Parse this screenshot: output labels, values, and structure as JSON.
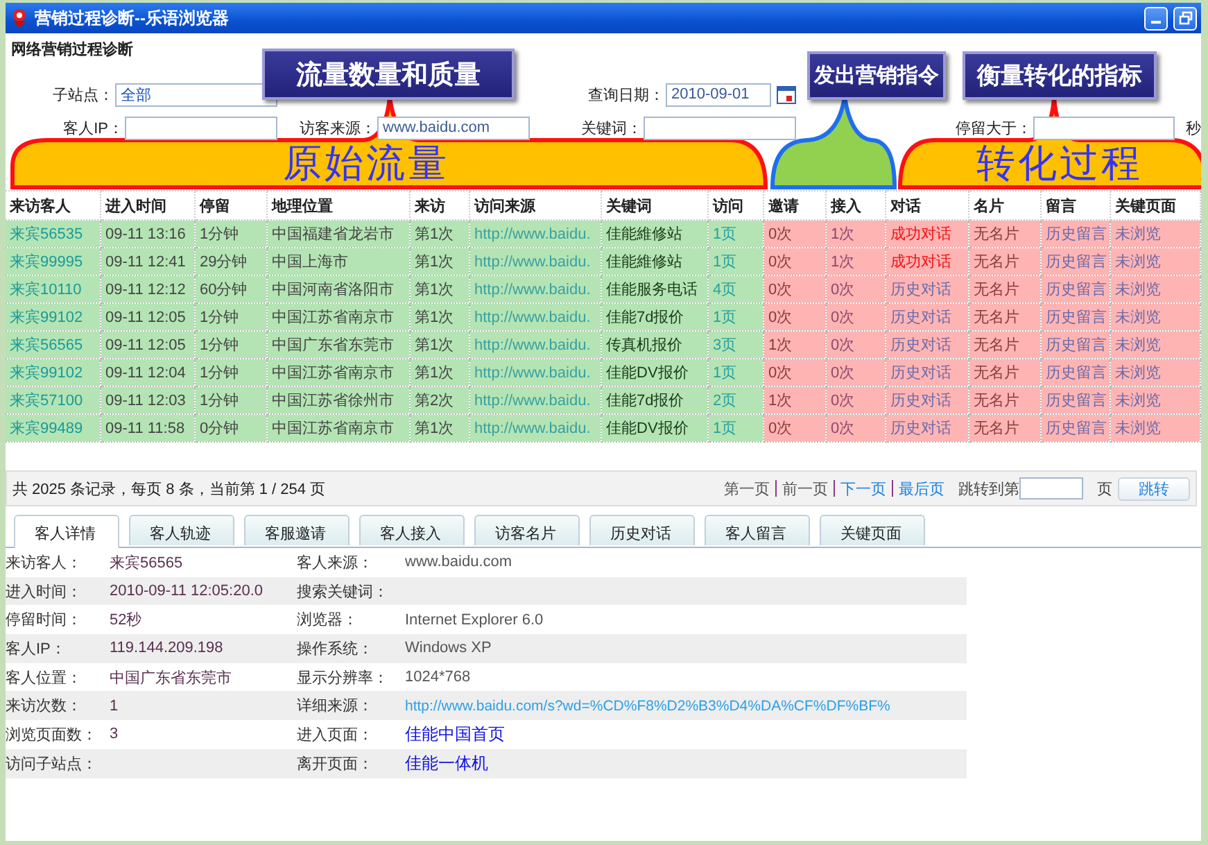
{
  "window": {
    "title": "营销过程诊断--乐语浏览器"
  },
  "page_title": "网络营销过程诊断",
  "filters": [
    {
      "label": "子站点：",
      "kind": "select",
      "value": "全部"
    },
    {
      "label": "查询日期：",
      "kind": "date",
      "value": "2010-09-01"
    },
    {
      "label": "客人IP：",
      "kind": "text"
    },
    {
      "label": "访客来源：",
      "kind": "text",
      "value": "www.baidu.com"
    },
    {
      "label": "关键词：",
      "kind": "text"
    },
    {
      "label": "停留大于：",
      "kind": "text",
      "unit": "秒"
    }
  ],
  "table": {
    "columns": [
      {
        "label": "来访客人",
        "kind": "traffic"
      },
      {
        "label": "进入时间",
        "kind": "traffic"
      },
      {
        "label": "停留",
        "kind": "traffic"
      },
      {
        "label": "地理位置",
        "kind": "traffic"
      },
      {
        "label": "来访",
        "kind": "traffic"
      },
      {
        "label": "访问来源",
        "kind": "traffic"
      },
      {
        "label": "关键词",
        "kind": "traffic"
      },
      {
        "label": "访问",
        "kind": "traffic"
      },
      {
        "label": "邀请",
        "kind": "conversion"
      },
      {
        "label": "接入",
        "kind": "conversion"
      },
      {
        "label": "对话",
        "kind": "conversion"
      },
      {
        "label": "名片",
        "kind": "conversion"
      },
      {
        "label": "留言",
        "kind": "conversion"
      },
      {
        "label": "关键页面",
        "kind": "conversion"
      }
    ],
    "rows": [
      {
        "cells": [
          "来宾56535",
          "09-11 13:16",
          "1分钟",
          "中国福建省龙岩市",
          "第1次",
          "http://www.baidu.",
          "佳能維修站",
          "1页",
          "0次",
          "1次",
          "成功对话",
          "无名片",
          "历史留言",
          "未浏览"
        ],
        "dialog_success": true
      },
      {
        "cells": [
          "来宾99995",
          "09-11 12:41",
          "29分钟",
          "中国上海市",
          "第1次",
          "http://www.baidu.",
          "佳能維修站",
          "1页",
          "0次",
          "1次",
          "成功对话",
          "无名片",
          "历史留言",
          "未浏览"
        ],
        "dialog_success": true
      },
      {
        "cells": [
          "来宾10110",
          "09-11 12:12",
          "60分钟",
          "中国河南省洛阳市",
          "第1次",
          "http://www.baidu.",
          "佳能服务电话",
          "4页",
          "0次",
          "0次",
          "历史对话",
          "无名片",
          "历史留言",
          "未浏览"
        ],
        "dialog_success": false
      },
      {
        "cells": [
          "来宾99102",
          "09-11 12:05",
          "1分钟",
          "中国江苏省南京市",
          "第1次",
          "http://www.baidu.",
          "佳能7d报价",
          "1页",
          "0次",
          "0次",
          "历史对话",
          "无名片",
          "历史留言",
          "未浏览"
        ],
        "dialog_success": false
      },
      {
        "cells": [
          "来宾56565",
          "09-11 12:05",
          "1分钟",
          "中国广东省东莞市",
          "第1次",
          "http://www.baidu.",
          "传真机报价",
          "3页",
          "1次",
          "0次",
          "历史对话",
          "无名片",
          "历史留言",
          "未浏览"
        ],
        "dialog_success": false
      },
      {
        "cells": [
          "来宾99102",
          "09-11 12:04",
          "1分钟",
          "中国江苏省南京市",
          "第1次",
          "http://www.baidu.",
          "佳能DV报价",
          "1页",
          "0次",
          "0次",
          "历史对话",
          "无名片",
          "历史留言",
          "未浏览"
        ],
        "dialog_success": false
      },
      {
        "cells": [
          "来宾57100",
          "09-11 12:03",
          "1分钟",
          "中国江苏省徐州市",
          "第2次",
          "http://www.baidu.",
          "佳能7d报价",
          "2页",
          "1次",
          "0次",
          "历史对话",
          "无名片",
          "历史留言",
          "未浏览"
        ],
        "dialog_success": false
      },
      {
        "cells": [
          "来宾99489",
          "09-11 11:58",
          "0分钟",
          "中国江苏省南京市",
          "第1次",
          "http://www.baidu.",
          "佳能DV报价",
          "1页",
          "0次",
          "0次",
          "历史对话",
          "无名片",
          "历史留言",
          "未浏览"
        ],
        "dialog_success": false
      }
    ]
  },
  "pagination": {
    "summary": "共 2025 条记录，每页 8 条，当前第 1 / 254 页",
    "links": [
      {
        "label": "第一页",
        "disabled": true
      },
      {
        "label": "前一页",
        "disabled": true
      },
      {
        "label": "下一页",
        "disabled": false
      },
      {
        "label": "最后页",
        "disabled": false
      }
    ],
    "jump_label": "跳转到第",
    "page_unit": "页",
    "button": "跳转"
  },
  "tabs": [
    {
      "label": "客人详情",
      "selected": true
    },
    {
      "label": "客人轨迹",
      "selected": false
    },
    {
      "label": "客服邀请",
      "selected": false
    },
    {
      "label": "客人接入",
      "selected": false
    },
    {
      "label": "访客名片",
      "selected": false
    },
    {
      "label": "历史对话",
      "selected": false
    },
    {
      "label": "客人留言",
      "selected": false
    },
    {
      "label": "关键页面",
      "selected": false
    }
  ],
  "details": [
    {
      "label": "来访客人：",
      "value": "来宾56565",
      "label2": "客人来源：",
      "value2": "www.baidu.com",
      "kind": "text"
    },
    {
      "label": "进入时间：",
      "value": "2010-09-11 12:05:20.0",
      "label2": "搜索关键词：",
      "kind": "text"
    },
    {
      "label": "停留时间：",
      "value": "52秒",
      "label2": "浏览器：",
      "value2": "Internet Explorer 6.0",
      "kind": "text"
    },
    {
      "label": "客人IP：",
      "value": "119.144.209.198",
      "label2": "操作系统：",
      "value2": "Windows XP",
      "kind": "text"
    },
    {
      "label": "客人位置：",
      "value": "中国广东省东莞市",
      "label2": "显示分辨率：",
      "value2": "1024*768",
      "kind": "text"
    },
    {
      "label": "来访次数：",
      "value": "1",
      "label2": "详细来源：",
      "value2": "http://www.baidu.com/s?wd=%CD%F8%D2%B3%D4%DA%CF%DF%BF%",
      "kind": "url"
    },
    {
      "label": "浏览页面数：",
      "value": "3",
      "label2": "进入页面：",
      "value2": "佳能中国首页",
      "kind": "page"
    },
    {
      "label": "访问子站点：",
      "label2": "离开页面：",
      "value2": "佳能一体机",
      "kind": "page"
    }
  ],
  "callouts": [
    {
      "text": "流量数量和质量",
      "kind": "traffic"
    },
    {
      "text": "发出营销指令",
      "kind": "command"
    },
    {
      "text": "衡量转化的指标",
      "kind": "metric"
    }
  ],
  "captions": [
    "原始流量",
    "转化过程"
  ]
}
